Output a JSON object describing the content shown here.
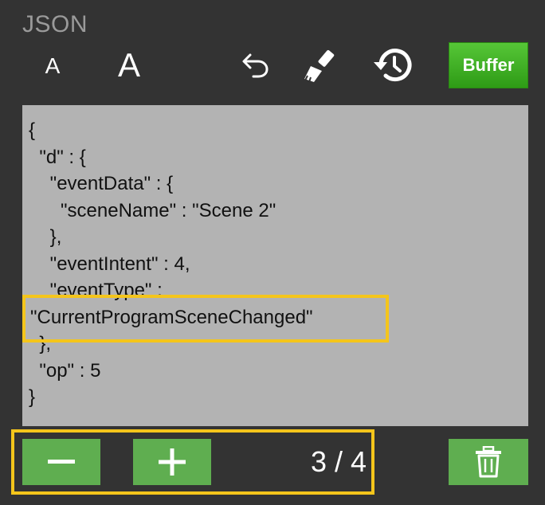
{
  "header": {
    "title": "JSON",
    "font_small_label": "A",
    "font_large_label": "A",
    "buffer_label": "Buffer"
  },
  "icons": {
    "undo": "undo-icon",
    "clear": "brush-icon",
    "history": "history-icon",
    "minus": "minus-icon",
    "plus": "plus-icon",
    "trash": "trash-icon"
  },
  "json_lines": [
    "{",
    "  \"d\" : {",
    "    \"eventData\" : {",
    "      \"sceneName\" : \"Scene 2\"",
    "    },",
    "    \"eventIntent\" : 4,",
    "    \"eventType\" :",
    "\"CurrentProgramSceneChanged\"",
    "  },",
    "  \"op\" : 5",
    "}"
  ],
  "pager": {
    "current": "3",
    "total": "4",
    "display": "3 / 4"
  },
  "colors": {
    "background": "#333333",
    "panel": "#b3b3b3",
    "button_green": "#5fae50",
    "buffer_green": "#3aa61c",
    "highlight": "#f4c51b"
  }
}
